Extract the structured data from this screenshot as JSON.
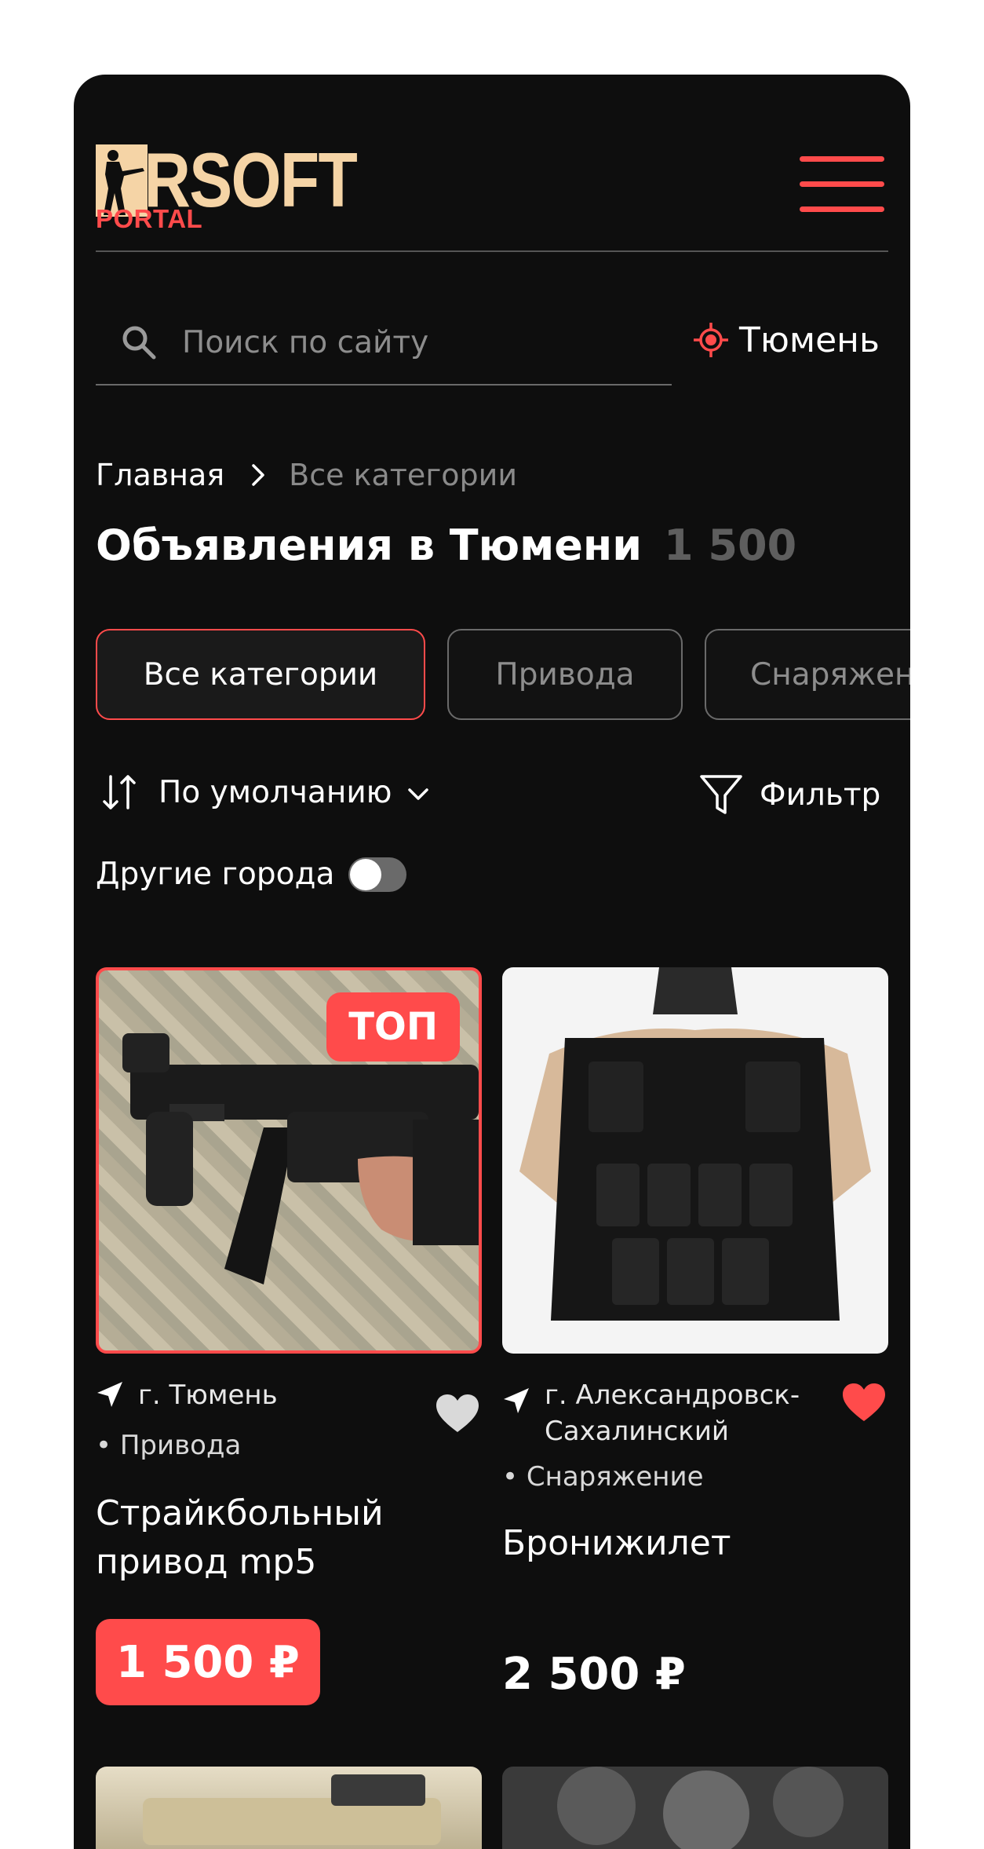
{
  "header": {
    "logo_word": "IRSOFT",
    "logo_sub": "PORTAL",
    "menu_icon": "hamburger-icon"
  },
  "search": {
    "placeholder": "Поиск по сайту",
    "value": ""
  },
  "city": {
    "label": "Тюмень",
    "icon": "location-target-icon"
  },
  "breadcrumb": {
    "home": "Главная",
    "current": "Все категории"
  },
  "page": {
    "title": "Объявления в Тюмени",
    "count": "1 500"
  },
  "chips": [
    {
      "label": "Все категории",
      "active": true
    },
    {
      "label": "Привода",
      "active": false
    },
    {
      "label": "Снаряжение",
      "active": false
    }
  ],
  "sort": {
    "label": "По умолчанию"
  },
  "filter": {
    "label": "Фильтр"
  },
  "other_cities": {
    "label": "Другие города",
    "enabled": false
  },
  "listings": [
    {
      "badge": "ТОП",
      "city": "г. Тюмень",
      "category": "• Привода",
      "title": "Страйкбольный привод mp5",
      "price": "1 500 ₽",
      "favorite": false,
      "highlighted": true
    },
    {
      "badge": "",
      "city": "г. Александровск-Сахалинский",
      "category": "• Снаряжение",
      "title": "Бронижилет",
      "price": "2 500 ₽",
      "favorite": true,
      "highlighted": false
    }
  ],
  "colors": {
    "accent": "#ff4b4b",
    "logo": "#f5d4a6",
    "background": "#0e0e0e",
    "muted": "#8d8d8d"
  }
}
